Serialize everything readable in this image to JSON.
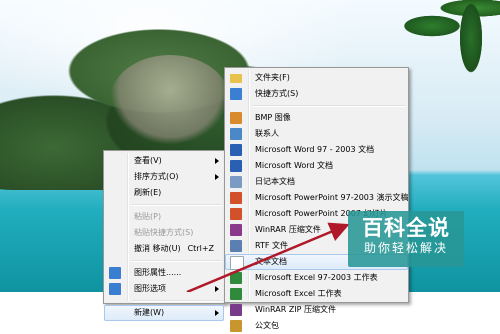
{
  "main_menu": {
    "items": [
      {
        "label": "查看(V)",
        "arrow": true
      },
      {
        "label": "排序方式(O)",
        "arrow": true
      },
      {
        "label": "刷新(E)"
      },
      {
        "sep": true
      },
      {
        "label": "粘贴(P)",
        "disabled": true
      },
      {
        "label": "粘贴快捷方式(S)",
        "disabled": true
      },
      {
        "label": "撤消 移动(U)",
        "shortcut": "Ctrl+Z"
      },
      {
        "sep": true
      },
      {
        "label": "图形属性......",
        "icon": "graphics-properties-icon"
      },
      {
        "label": "图形选项",
        "icon": "graphics-options-icon",
        "arrow": true
      },
      {
        "sep": true
      },
      {
        "label": "新建(W)",
        "arrow": true,
        "highlighted": true
      }
    ]
  },
  "new_submenu": {
    "items": [
      {
        "label": "文件夹(F)",
        "icon": "folder-icon"
      },
      {
        "label": "快捷方式(S)",
        "icon": "shortcut-icon"
      },
      {
        "sep": true
      },
      {
        "label": "BMP 图像",
        "icon": "bmp-image-icon"
      },
      {
        "label": "联系人",
        "icon": "contact-icon"
      },
      {
        "label": "Microsoft Word 97 - 2003 文档",
        "icon": "word-icon"
      },
      {
        "label": "Microsoft Word 文档",
        "icon": "word-icon"
      },
      {
        "label": "日记本文档",
        "icon": "journal-icon"
      },
      {
        "label": "Microsoft PowerPoint 97-2003 演示文稿",
        "icon": "powerpoint-icon"
      },
      {
        "label": "Microsoft PowerPoint 2007 幻灯片",
        "icon": "powerpoint-icon"
      },
      {
        "label": "WinRAR 压缩文件",
        "icon": "winrar-icon"
      },
      {
        "label": "RTF 文件",
        "icon": "rtf-icon"
      },
      {
        "label": "文本文档",
        "icon": "text-document-icon",
        "highlighted": true
      },
      {
        "label": "Microsoft Excel 97-2003 工作表",
        "icon": "excel-icon"
      },
      {
        "label": "Microsoft Excel 工作表",
        "icon": "excel-icon"
      },
      {
        "label": "WinRAR ZIP 压缩文件",
        "icon": "winrar-zip-icon"
      },
      {
        "label": "公文包",
        "icon": "briefcase-icon"
      }
    ]
  },
  "icon_colors": {
    "folder-icon": "#e8c24a",
    "shortcut-icon": "#3b7fd4",
    "bmp-image-icon": "#d98a2a",
    "contact-icon": "#4a88c8",
    "word-icon": "#2b5fb4",
    "journal-icon": "#7a9cc4",
    "powerpoint-icon": "#d2502a",
    "winrar-icon": "#8b3a8b",
    "rtf-icon": "#5a7fb0",
    "text-document-icon": "#ffffff",
    "excel-icon": "#2f8a3c",
    "winrar-zip-icon": "#7a3a8a",
    "briefcase-icon": "#c9962e",
    "graphics-properties-icon": "#3a7ed1",
    "graphics-options-icon": "#3a7ed1"
  },
  "watermark": {
    "title": "百科全说",
    "subtitle": "助你轻松解决"
  },
  "colors": {
    "annotation_arrow": "#b0192a",
    "badge_bg": "#2a9696"
  }
}
